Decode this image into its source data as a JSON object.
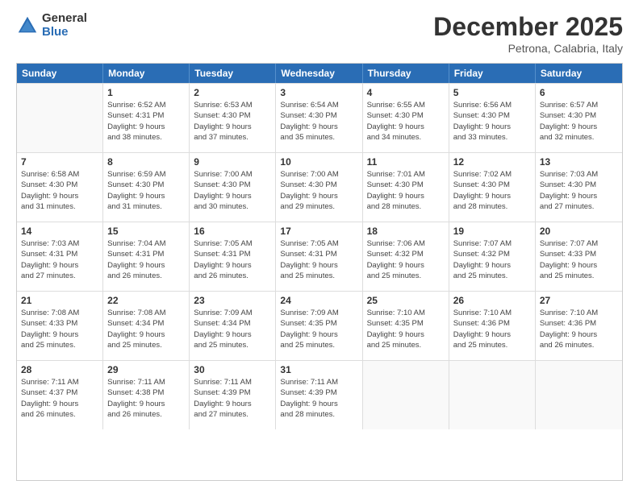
{
  "logo": {
    "general": "General",
    "blue": "Blue"
  },
  "header": {
    "month": "December 2025",
    "location": "Petrona, Calabria, Italy"
  },
  "days": [
    "Sunday",
    "Monday",
    "Tuesday",
    "Wednesday",
    "Thursday",
    "Friday",
    "Saturday"
  ],
  "weeks": [
    [
      {
        "day": "",
        "info": ""
      },
      {
        "day": "1",
        "info": "Sunrise: 6:52 AM\nSunset: 4:31 PM\nDaylight: 9 hours\nand 38 minutes."
      },
      {
        "day": "2",
        "info": "Sunrise: 6:53 AM\nSunset: 4:30 PM\nDaylight: 9 hours\nand 37 minutes."
      },
      {
        "day": "3",
        "info": "Sunrise: 6:54 AM\nSunset: 4:30 PM\nDaylight: 9 hours\nand 35 minutes."
      },
      {
        "day": "4",
        "info": "Sunrise: 6:55 AM\nSunset: 4:30 PM\nDaylight: 9 hours\nand 34 minutes."
      },
      {
        "day": "5",
        "info": "Sunrise: 6:56 AM\nSunset: 4:30 PM\nDaylight: 9 hours\nand 33 minutes."
      },
      {
        "day": "6",
        "info": "Sunrise: 6:57 AM\nSunset: 4:30 PM\nDaylight: 9 hours\nand 32 minutes."
      }
    ],
    [
      {
        "day": "7",
        "info": "Sunrise: 6:58 AM\nSunset: 4:30 PM\nDaylight: 9 hours\nand 31 minutes."
      },
      {
        "day": "8",
        "info": "Sunrise: 6:59 AM\nSunset: 4:30 PM\nDaylight: 9 hours\nand 31 minutes."
      },
      {
        "day": "9",
        "info": "Sunrise: 7:00 AM\nSunset: 4:30 PM\nDaylight: 9 hours\nand 30 minutes."
      },
      {
        "day": "10",
        "info": "Sunrise: 7:00 AM\nSunset: 4:30 PM\nDaylight: 9 hours\nand 29 minutes."
      },
      {
        "day": "11",
        "info": "Sunrise: 7:01 AM\nSunset: 4:30 PM\nDaylight: 9 hours\nand 28 minutes."
      },
      {
        "day": "12",
        "info": "Sunrise: 7:02 AM\nSunset: 4:30 PM\nDaylight: 9 hours\nand 28 minutes."
      },
      {
        "day": "13",
        "info": "Sunrise: 7:03 AM\nSunset: 4:30 PM\nDaylight: 9 hours\nand 27 minutes."
      }
    ],
    [
      {
        "day": "14",
        "info": "Sunrise: 7:03 AM\nSunset: 4:31 PM\nDaylight: 9 hours\nand 27 minutes."
      },
      {
        "day": "15",
        "info": "Sunrise: 7:04 AM\nSunset: 4:31 PM\nDaylight: 9 hours\nand 26 minutes."
      },
      {
        "day": "16",
        "info": "Sunrise: 7:05 AM\nSunset: 4:31 PM\nDaylight: 9 hours\nand 26 minutes."
      },
      {
        "day": "17",
        "info": "Sunrise: 7:05 AM\nSunset: 4:31 PM\nDaylight: 9 hours\nand 25 minutes."
      },
      {
        "day": "18",
        "info": "Sunrise: 7:06 AM\nSunset: 4:32 PM\nDaylight: 9 hours\nand 25 minutes."
      },
      {
        "day": "19",
        "info": "Sunrise: 7:07 AM\nSunset: 4:32 PM\nDaylight: 9 hours\nand 25 minutes."
      },
      {
        "day": "20",
        "info": "Sunrise: 7:07 AM\nSunset: 4:33 PM\nDaylight: 9 hours\nand 25 minutes."
      }
    ],
    [
      {
        "day": "21",
        "info": "Sunrise: 7:08 AM\nSunset: 4:33 PM\nDaylight: 9 hours\nand 25 minutes."
      },
      {
        "day": "22",
        "info": "Sunrise: 7:08 AM\nSunset: 4:34 PM\nDaylight: 9 hours\nand 25 minutes."
      },
      {
        "day": "23",
        "info": "Sunrise: 7:09 AM\nSunset: 4:34 PM\nDaylight: 9 hours\nand 25 minutes."
      },
      {
        "day": "24",
        "info": "Sunrise: 7:09 AM\nSunset: 4:35 PM\nDaylight: 9 hours\nand 25 minutes."
      },
      {
        "day": "25",
        "info": "Sunrise: 7:10 AM\nSunset: 4:35 PM\nDaylight: 9 hours\nand 25 minutes."
      },
      {
        "day": "26",
        "info": "Sunrise: 7:10 AM\nSunset: 4:36 PM\nDaylight: 9 hours\nand 25 minutes."
      },
      {
        "day": "27",
        "info": "Sunrise: 7:10 AM\nSunset: 4:36 PM\nDaylight: 9 hours\nand 26 minutes."
      }
    ],
    [
      {
        "day": "28",
        "info": "Sunrise: 7:11 AM\nSunset: 4:37 PM\nDaylight: 9 hours\nand 26 minutes."
      },
      {
        "day": "29",
        "info": "Sunrise: 7:11 AM\nSunset: 4:38 PM\nDaylight: 9 hours\nand 26 minutes."
      },
      {
        "day": "30",
        "info": "Sunrise: 7:11 AM\nSunset: 4:39 PM\nDaylight: 9 hours\nand 27 minutes."
      },
      {
        "day": "31",
        "info": "Sunrise: 7:11 AM\nSunset: 4:39 PM\nDaylight: 9 hours\nand 28 minutes."
      },
      {
        "day": "",
        "info": ""
      },
      {
        "day": "",
        "info": ""
      },
      {
        "day": "",
        "info": ""
      }
    ]
  ]
}
